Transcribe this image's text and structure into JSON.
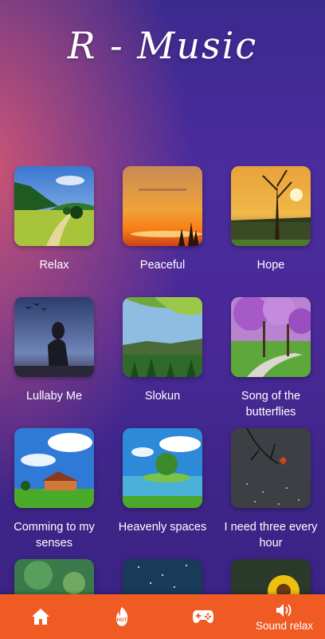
{
  "app_title": "R -  Music",
  "sounds": [
    {
      "label": "Relax",
      "thumb": "meadow-path"
    },
    {
      "label": "Peaceful",
      "thumb": "sunset-sea"
    },
    {
      "label": "Hope",
      "thumb": "sunrise-tree"
    },
    {
      "label": "Lullaby Me",
      "thumb": "silhouette-dusk"
    },
    {
      "label": "Slokun",
      "thumb": "forest-valley"
    },
    {
      "label": "Song of the butterflies",
      "thumb": "purple-blossom-park"
    },
    {
      "label": "Comming to my senses",
      "thumb": "cottage-field"
    },
    {
      "label": "Heavenly spaces",
      "thumb": "lake-island"
    },
    {
      "label": "I need three every hour",
      "thumb": "rain-leaf"
    },
    {
      "label": "",
      "thumb": "green-bokeh"
    },
    {
      "label": "",
      "thumb": "starry-night"
    },
    {
      "label": "",
      "thumb": "sunflower"
    }
  ],
  "nav": [
    {
      "icon": "home-icon",
      "label": ""
    },
    {
      "icon": "hot-icon",
      "label": ""
    },
    {
      "icon": "gamepad-icon",
      "label": ""
    },
    {
      "icon": "speaker-icon",
      "label": "Sound relax"
    }
  ],
  "colors": {
    "navbar": "#ef5b22",
    "background": "#4a2c9c",
    "accent": "#e45c6c"
  }
}
